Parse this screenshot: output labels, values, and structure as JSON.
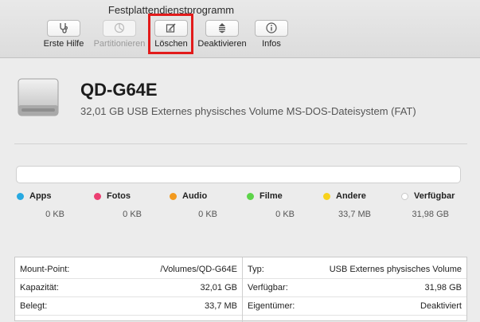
{
  "window": {
    "title": "Festplattendienstprogramm"
  },
  "toolbar": {
    "first_aid": "Erste Hilfe",
    "partition": "Partitionieren",
    "erase": "Löschen",
    "unmount": "Deaktivieren",
    "info": "Infos"
  },
  "volume": {
    "name": "QD-G64E",
    "description": "32,01 GB USB Externes physisches Volume MS-DOS-Dateisystem (FAT)"
  },
  "usage": {
    "categories": [
      {
        "name": "Apps",
        "size": "0 KB",
        "color": "#27a9e1"
      },
      {
        "name": "Fotos",
        "size": "0 KB",
        "color": "#ec3f72"
      },
      {
        "name": "Audio",
        "size": "0 KB",
        "color": "#f39a1e"
      },
      {
        "name": "Filme",
        "size": "0 KB",
        "color": "#5dd44a"
      },
      {
        "name": "Andere",
        "size": "33,7 MB",
        "color": "#f8d21c"
      },
      {
        "name": "Verfügbar",
        "size": "31,98 GB",
        "color": "#ffffff"
      }
    ]
  },
  "info": {
    "left": [
      {
        "key": "Mount-Point:",
        "value": "/Volumes/QD-G64E"
      },
      {
        "key": "Kapazität:",
        "value": "32,01 GB"
      },
      {
        "key": "Belegt:",
        "value": "33,7 MB"
      }
    ],
    "right": [
      {
        "key": "Typ:",
        "value": "USB Externes physisches Volume"
      },
      {
        "key": "Verfügbar:",
        "value": "31,98 GB"
      },
      {
        "key": "Eigentümer:",
        "value": "Deaktiviert"
      }
    ]
  }
}
